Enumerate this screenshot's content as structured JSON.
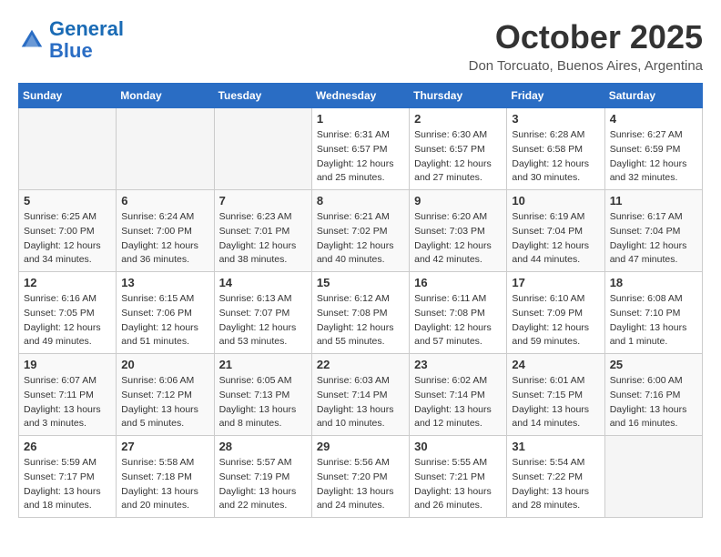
{
  "header": {
    "logo_line1": "General",
    "logo_line2": "Blue",
    "month": "October 2025",
    "location": "Don Torcuato, Buenos Aires, Argentina"
  },
  "weekdays": [
    "Sunday",
    "Monday",
    "Tuesday",
    "Wednesday",
    "Thursday",
    "Friday",
    "Saturday"
  ],
  "weeks": [
    [
      {
        "day": "",
        "info": ""
      },
      {
        "day": "",
        "info": ""
      },
      {
        "day": "",
        "info": ""
      },
      {
        "day": "1",
        "info": "Sunrise: 6:31 AM\nSunset: 6:57 PM\nDaylight: 12 hours\nand 25 minutes."
      },
      {
        "day": "2",
        "info": "Sunrise: 6:30 AM\nSunset: 6:57 PM\nDaylight: 12 hours\nand 27 minutes."
      },
      {
        "day": "3",
        "info": "Sunrise: 6:28 AM\nSunset: 6:58 PM\nDaylight: 12 hours\nand 30 minutes."
      },
      {
        "day": "4",
        "info": "Sunrise: 6:27 AM\nSunset: 6:59 PM\nDaylight: 12 hours\nand 32 minutes."
      }
    ],
    [
      {
        "day": "5",
        "info": "Sunrise: 6:25 AM\nSunset: 7:00 PM\nDaylight: 12 hours\nand 34 minutes."
      },
      {
        "day": "6",
        "info": "Sunrise: 6:24 AM\nSunset: 7:00 PM\nDaylight: 12 hours\nand 36 minutes."
      },
      {
        "day": "7",
        "info": "Sunrise: 6:23 AM\nSunset: 7:01 PM\nDaylight: 12 hours\nand 38 minutes."
      },
      {
        "day": "8",
        "info": "Sunrise: 6:21 AM\nSunset: 7:02 PM\nDaylight: 12 hours\nand 40 minutes."
      },
      {
        "day": "9",
        "info": "Sunrise: 6:20 AM\nSunset: 7:03 PM\nDaylight: 12 hours\nand 42 minutes."
      },
      {
        "day": "10",
        "info": "Sunrise: 6:19 AM\nSunset: 7:04 PM\nDaylight: 12 hours\nand 44 minutes."
      },
      {
        "day": "11",
        "info": "Sunrise: 6:17 AM\nSunset: 7:04 PM\nDaylight: 12 hours\nand 47 minutes."
      }
    ],
    [
      {
        "day": "12",
        "info": "Sunrise: 6:16 AM\nSunset: 7:05 PM\nDaylight: 12 hours\nand 49 minutes."
      },
      {
        "day": "13",
        "info": "Sunrise: 6:15 AM\nSunset: 7:06 PM\nDaylight: 12 hours\nand 51 minutes."
      },
      {
        "day": "14",
        "info": "Sunrise: 6:13 AM\nSunset: 7:07 PM\nDaylight: 12 hours\nand 53 minutes."
      },
      {
        "day": "15",
        "info": "Sunrise: 6:12 AM\nSunset: 7:08 PM\nDaylight: 12 hours\nand 55 minutes."
      },
      {
        "day": "16",
        "info": "Sunrise: 6:11 AM\nSunset: 7:08 PM\nDaylight: 12 hours\nand 57 minutes."
      },
      {
        "day": "17",
        "info": "Sunrise: 6:10 AM\nSunset: 7:09 PM\nDaylight: 12 hours\nand 59 minutes."
      },
      {
        "day": "18",
        "info": "Sunrise: 6:08 AM\nSunset: 7:10 PM\nDaylight: 13 hours\nand 1 minute."
      }
    ],
    [
      {
        "day": "19",
        "info": "Sunrise: 6:07 AM\nSunset: 7:11 PM\nDaylight: 13 hours\nand 3 minutes."
      },
      {
        "day": "20",
        "info": "Sunrise: 6:06 AM\nSunset: 7:12 PM\nDaylight: 13 hours\nand 5 minutes."
      },
      {
        "day": "21",
        "info": "Sunrise: 6:05 AM\nSunset: 7:13 PM\nDaylight: 13 hours\nand 8 minutes."
      },
      {
        "day": "22",
        "info": "Sunrise: 6:03 AM\nSunset: 7:14 PM\nDaylight: 13 hours\nand 10 minutes."
      },
      {
        "day": "23",
        "info": "Sunrise: 6:02 AM\nSunset: 7:14 PM\nDaylight: 13 hours\nand 12 minutes."
      },
      {
        "day": "24",
        "info": "Sunrise: 6:01 AM\nSunset: 7:15 PM\nDaylight: 13 hours\nand 14 minutes."
      },
      {
        "day": "25",
        "info": "Sunrise: 6:00 AM\nSunset: 7:16 PM\nDaylight: 13 hours\nand 16 minutes."
      }
    ],
    [
      {
        "day": "26",
        "info": "Sunrise: 5:59 AM\nSunset: 7:17 PM\nDaylight: 13 hours\nand 18 minutes."
      },
      {
        "day": "27",
        "info": "Sunrise: 5:58 AM\nSunset: 7:18 PM\nDaylight: 13 hours\nand 20 minutes."
      },
      {
        "day": "28",
        "info": "Sunrise: 5:57 AM\nSunset: 7:19 PM\nDaylight: 13 hours\nand 22 minutes."
      },
      {
        "day": "29",
        "info": "Sunrise: 5:56 AM\nSunset: 7:20 PM\nDaylight: 13 hours\nand 24 minutes."
      },
      {
        "day": "30",
        "info": "Sunrise: 5:55 AM\nSunset: 7:21 PM\nDaylight: 13 hours\nand 26 minutes."
      },
      {
        "day": "31",
        "info": "Sunrise: 5:54 AM\nSunset: 7:22 PM\nDaylight: 13 hours\nand 28 minutes."
      },
      {
        "day": "",
        "info": ""
      }
    ]
  ]
}
